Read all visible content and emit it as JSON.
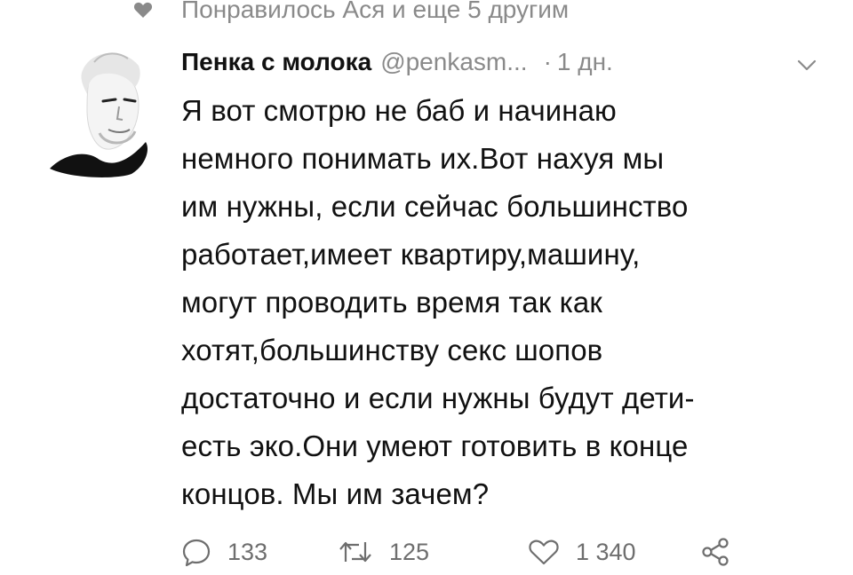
{
  "liked_by": {
    "text": "Понравилось Ася и еще 5 другим",
    "icon": "heart-icon"
  },
  "tweet": {
    "author_name": "Пенка с молока",
    "handle": "@penkasm...",
    "time": "1 дн.",
    "body": "Я вот смотрю не баб и начинаю\nнемного понимать их.Вот нахуя мы\nим нужны, если сейчас большинство\nработает,имеет квартиру,машину,\nмогут проводить время так как\nхотят,большинству секс шопов\nдостаточно и если нужны будут дети-\nесть эко.Они умеют готовить в конце\nконцов. Мы им зачем?",
    "replies": "133",
    "retweets": "125",
    "likes": "1 340"
  },
  "colors": {
    "text": "#111111",
    "muted": "#8a8a8a",
    "icon": "#6e6e6e"
  }
}
